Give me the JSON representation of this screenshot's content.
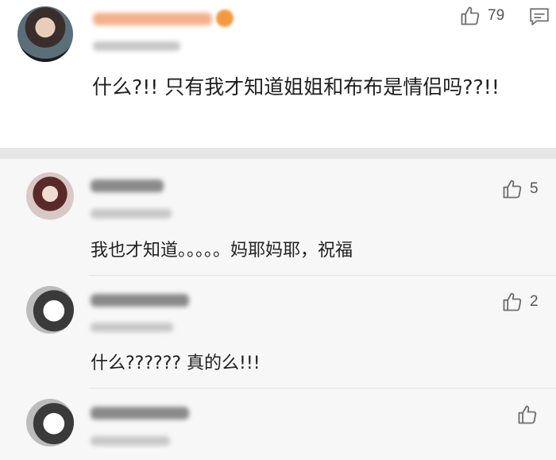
{
  "main_comment": {
    "like_count": "79",
    "text": "什么?!! 只有我才知道姐姐和布布是情侣吗??!!"
  },
  "replies": [
    {
      "text": "我也才知道。。。。。妈耶妈耶，祝福",
      "like_count": "5"
    },
    {
      "text": "什么?????? 真的么!!!",
      "like_count": "2"
    },
    {
      "text": "",
      "like_count": ""
    }
  ],
  "colors": {
    "name_blur_main": "#f0a070",
    "divider": "#e6e6e6",
    "reply_background": "#f7f7f7",
    "icon_gray": "#777777"
  },
  "icons": [
    "thumbs-up-icon",
    "reply-icon"
  ]
}
